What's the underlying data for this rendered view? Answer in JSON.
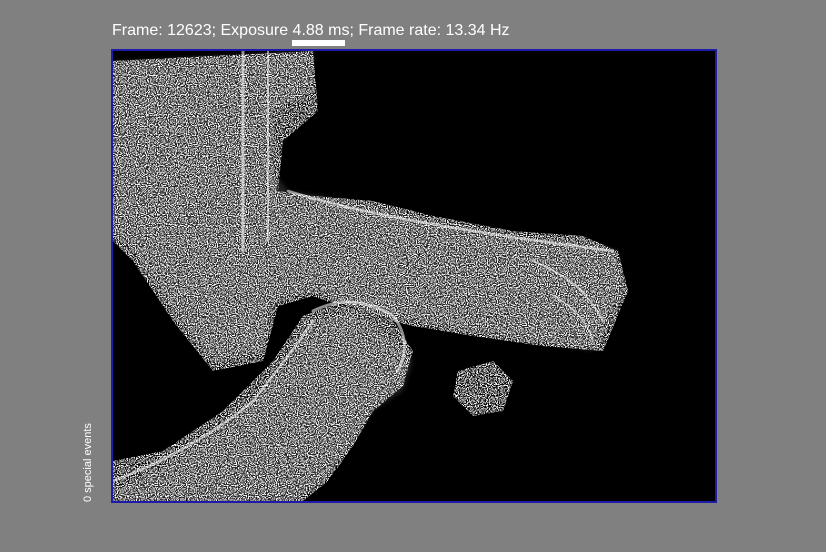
{
  "status": {
    "text": "Frame: 12623; Exposure 4.88 ms; Frame rate: 13.34 Hz"
  },
  "exposure_bar": {
    "fill_fraction": 1.0
  },
  "viewer": {
    "border_color": "#1c1ca8",
    "background_color": "#000000"
  },
  "side_label": {
    "text": "0 special events"
  }
}
